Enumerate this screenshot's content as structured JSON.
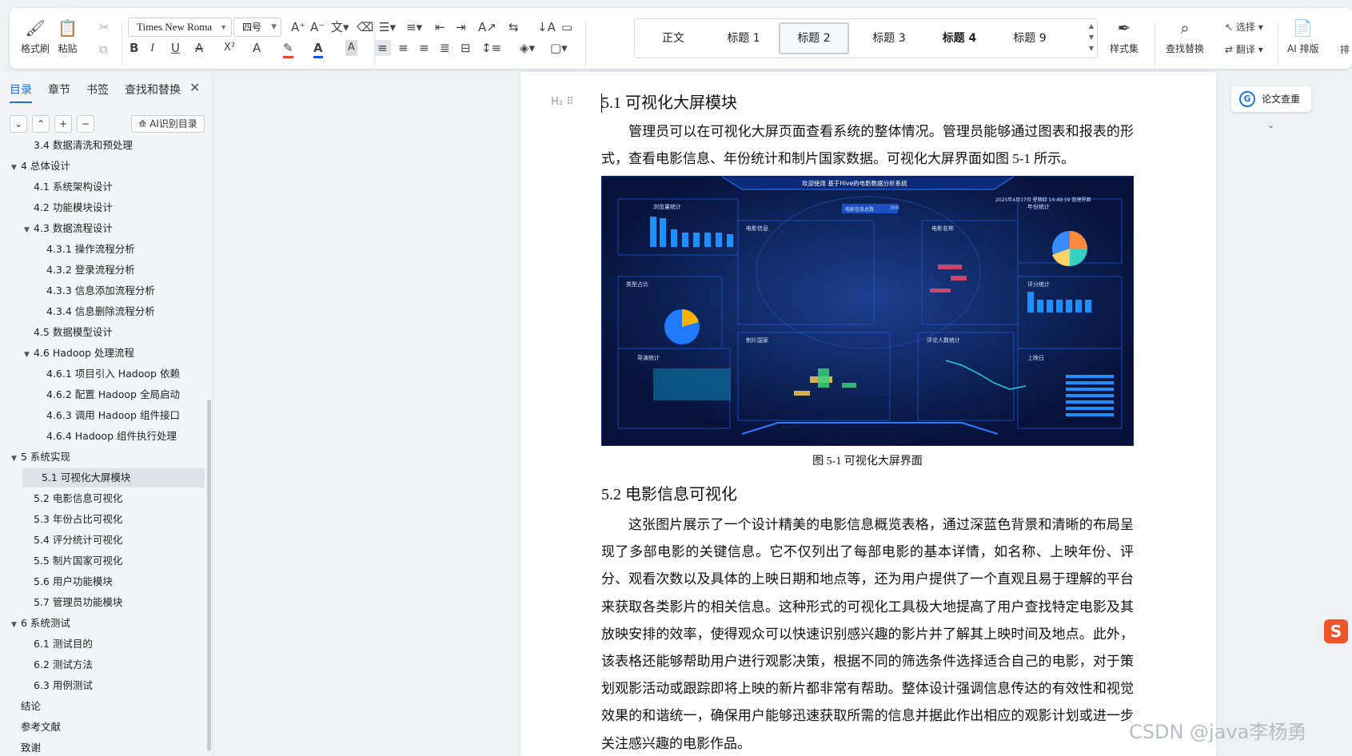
{
  "ribbon": {
    "format_painter": "格式刷",
    "paste": "粘贴",
    "font_name": "Times New Roma",
    "font_size": "四号",
    "bold": "B",
    "italic": "I",
    "underline": "U",
    "styles": [
      "正文",
      "标题 1",
      "标题 2",
      "标题 3",
      "标题 4",
      "标题 9"
    ],
    "style_set": "样式集",
    "find_replace": "查找替换",
    "select": "选择",
    "translate": "翻译",
    "ai_layout": "AI 排版",
    "extra": "排"
  },
  "nav": {
    "tabs": [
      "目录",
      "章节",
      "书签",
      "查找和替换"
    ],
    "ai_toc": "AI识别目录",
    "toc": [
      {
        "label": "3.4 数据清洗和预处理",
        "level": 2,
        "toggle": ""
      },
      {
        "label": "4 总体设计",
        "level": 1,
        "toggle": "▼"
      },
      {
        "label": "4.1 系统架构设计",
        "level": 2,
        "toggle": ""
      },
      {
        "label": "4.2 功能模块设计",
        "level": 2,
        "toggle": ""
      },
      {
        "label": "4.3 数据流程设计",
        "level": 2,
        "toggle": "▼"
      },
      {
        "label": "4.3.1 操作流程分析",
        "level": 3,
        "toggle": ""
      },
      {
        "label": "4.3.2 登录流程分析",
        "level": 3,
        "toggle": ""
      },
      {
        "label": "4.3.3 信息添加流程分析",
        "level": 3,
        "toggle": ""
      },
      {
        "label": "4.3.4 信息删除流程分析",
        "level": 3,
        "toggle": ""
      },
      {
        "label": "4.5  数据模型设计",
        "level": 2,
        "toggle": ""
      },
      {
        "label": "4.6 Hadoop 处理流程",
        "level": 2,
        "toggle": "▼"
      },
      {
        "label": "4.6.1  项目引入 Hadoop 依赖",
        "level": 3,
        "toggle": ""
      },
      {
        "label": "4.6.2  配置 Hadoop 全局启动",
        "level": 3,
        "toggle": ""
      },
      {
        "label": "4.6.3  调用 Hadoop 组件接口",
        "level": 3,
        "toggle": ""
      },
      {
        "label": "4.6.4 Hadoop 组件执行处理",
        "level": 3,
        "toggle": ""
      },
      {
        "label": "5 系统实现",
        "level": 1,
        "toggle": "▼"
      },
      {
        "label": "5.1  可视化大屏模块",
        "level": 2,
        "toggle": "",
        "selected": true
      },
      {
        "label": "5.2  电影信息可视化",
        "level": 2,
        "toggle": ""
      },
      {
        "label": "5.3  年份占比可视化",
        "level": 2,
        "toggle": ""
      },
      {
        "label": "5.4  评分统计可视化",
        "level": 2,
        "toggle": ""
      },
      {
        "label": "5.5  制片国家可视化",
        "level": 2,
        "toggle": ""
      },
      {
        "label": "5.6  用户功能模块",
        "level": 2,
        "toggle": ""
      },
      {
        "label": "5.7  管理员功能模块",
        "level": 2,
        "toggle": ""
      },
      {
        "label": "6 系统测试",
        "level": 1,
        "toggle": "▼"
      },
      {
        "label": "6.1  测试目的",
        "level": 2,
        "toggle": ""
      },
      {
        "label": "6.2  测试方法",
        "level": 2,
        "toggle": ""
      },
      {
        "label": "6.3  用例测试",
        "level": 2,
        "toggle": ""
      },
      {
        "label": "结论",
        "level": 1,
        "toggle": ""
      },
      {
        "label": "参考文献",
        "level": 1,
        "toggle": ""
      },
      {
        "label": "致谢",
        "level": 1,
        "toggle": ""
      }
    ]
  },
  "doc": {
    "heading_51": "5.1  可视化大屏模块",
    "para_51": "管理员可以在可视化大屏页面查看系统的整体情况。管理员能够通过图表和报表的形式，查看电影信息、年份统计和制片国家数据。可视化大屏界面如图 5-1 所示。",
    "caption": "图 5-1  可视化大屏界面",
    "heading_52": "5.2  电影信息可视化",
    "para_52": "这张图片展示了一个设计精美的电影信息概览表格，通过深蓝色背景和清晰的布局呈现了多部电影的关键信息。它不仅列出了每部电影的基本详情，如名称、上映年份、评分、观看次数以及具体的上映日期和地点等，还为用户提供了一个直观且易于理解的平台来获取各类影片的相关信息。这种形式的可视化工具极大地提高了用户查找特定电影及其放映安排的效率，使得观众可以快速识别感兴趣的影片并了解其上映时间及地点。此外，该表格还能够帮助用户进行观影决策，根据不同的筛选条件选择适合自己的电影，对于策划观影活动或跟踪即将上映的新片都非常有帮助。整体设计强调信息传达的有效性和视觉效果的和谐统一，确保用户能够迅速获取所需的信息并据此作出相应的观影计划或进一步关注感兴趣的电影作品。",
    "dashboard": {
      "title": "欢迎使用 基于Hive的电影数据分析系统",
      "datetime": "2025年4月17日 星期四 14:49:59  管理界面",
      "panels": [
        "浏览量统计",
        "电影信息",
        "电影名称",
        "年份统计",
        "类型占比",
        "评分统计",
        "导演统计",
        "制片国家",
        "评论人数统计",
        "上映日"
      ],
      "center_tab": "电影信息总数",
      "center_value": "300"
    }
  },
  "right_panel": {
    "label": "论文查重"
  },
  "watermark": "CSDN @java李杨勇",
  "colors": {
    "accent": "#1f6fe8",
    "dash_bg": "#06123a",
    "dash_bar": "#1e8fff"
  }
}
